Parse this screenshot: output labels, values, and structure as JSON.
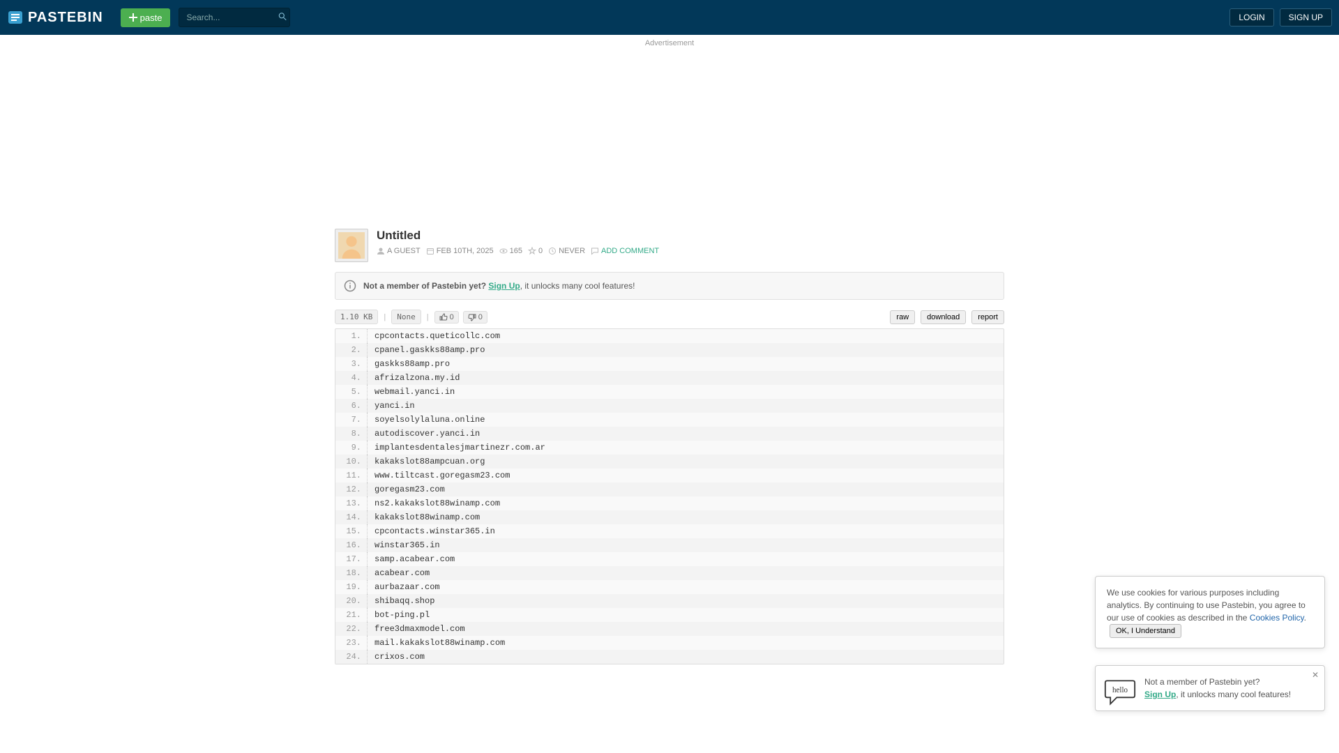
{
  "header": {
    "brand": "PASTEBIN",
    "paste_btn": "paste",
    "search_placeholder": "Search...",
    "login": "LOGIN",
    "signup": "SIGN UP"
  },
  "ad_label": "Advertisement",
  "paste": {
    "title": "Untitled",
    "author": "A GUEST",
    "date": "FEB 10TH, 2025",
    "views": "165",
    "stars": "0",
    "expires": "NEVER",
    "add_comment": "ADD COMMENT"
  },
  "notice": {
    "prefix": "Not a member of Pastebin yet?",
    "signup": "Sign Up",
    "suffix": ", it unlocks many cool features!"
  },
  "toolbar": {
    "size": "1.10 KB",
    "syntax": "None",
    "likes": "0",
    "dislikes": "0",
    "raw": "raw",
    "download": "download",
    "report": "report"
  },
  "lines": [
    "cpcontacts.queticollc.com",
    "cpanel.gaskks88amp.pro",
    "gaskks88amp.pro",
    "afrizalzona.my.id",
    "webmail.yanci.in",
    "yanci.in",
    "soyelsolylaluna.online",
    "autodiscover.yanci.in",
    "implantesdentalesjmartinezr.com.ar",
    "kakakslot88ampcuan.org",
    "www.tiltcast.goregasm23.com",
    "goregasm23.com",
    "ns2.kakakslot88winamp.com",
    "kakakslot88winamp.com",
    "cpcontacts.winstar365.in",
    "winstar365.in",
    "samp.acabear.com",
    "acabear.com",
    "aurbazaar.com",
    "shibaqq.shop",
    "bot-ping.pl",
    "free3dmaxmodel.com",
    "mail.kakakslot88winamp.com",
    "crixos.com"
  ],
  "cookie": {
    "text_prefix": "We use cookies for various purposes including analytics. By continuing to use Pastebin, you agree to our use of cookies as described in the ",
    "policy_link": "Cookies Policy",
    "ok": "OK, I Understand"
  },
  "popup": {
    "line1": "Not a member of Pastebin yet?",
    "signup": "Sign Up",
    "suffix": ", it unlocks many cool features!"
  }
}
